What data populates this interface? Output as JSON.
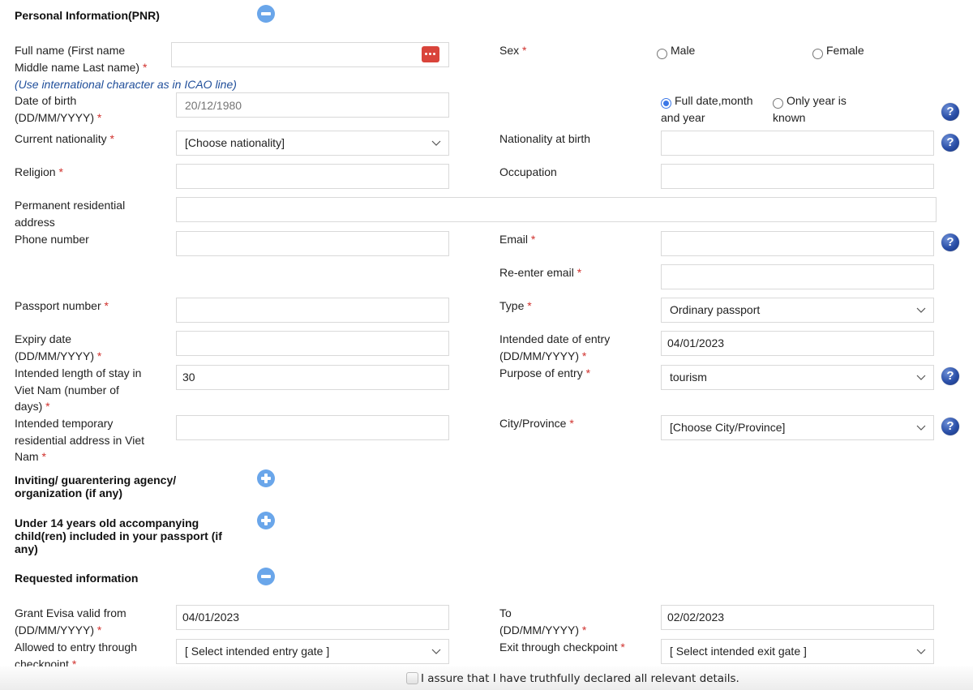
{
  "sections": {
    "personal": {
      "title": "Personal Information(PNR)",
      "toggle": "collapse"
    },
    "inviting": {
      "title_l1": "Inviting/ guarentering agency/",
      "title_l2": "organization (if any)",
      "toggle": "expand"
    },
    "children": {
      "title_l1": "Under 14 years old accompanying",
      "title_l2": "child(ren) included in your passport (if",
      "title_l3": "any)",
      "toggle": "expand"
    },
    "requested": {
      "title": "Requested information",
      "toggle": "collapse"
    }
  },
  "required_mark": "*",
  "fields": {
    "full_name": {
      "label_l1": "Full name (First name",
      "label_l2": "Middle name Last name)",
      "value": "",
      "note": "(Use international character as in ICAO line)"
    },
    "sex": {
      "label": "Sex",
      "options": [
        "Male",
        "Female"
      ],
      "selected": null
    },
    "dob": {
      "label_l1": "Date of birth",
      "label_l2": "(DD/MM/YYYY)",
      "placeholder": "20/12/1980",
      "value": ""
    },
    "dob_mode": {
      "options": [
        {
          "l1": "Full date,month",
          "l2": "and year"
        },
        {
          "l1": "Only year is",
          "l2": "known"
        }
      ],
      "selected": 0
    },
    "current_nationality": {
      "label": "Current nationality",
      "value": "[Choose nationality]"
    },
    "nationality_at_birth": {
      "label": "Nationality at birth",
      "value": ""
    },
    "religion": {
      "label": "Religion",
      "value": ""
    },
    "occupation": {
      "label": "Occupation",
      "value": ""
    },
    "permanent_address": {
      "label_l1": "Permanent residential",
      "label_l2": "address",
      "value": ""
    },
    "phone": {
      "label": "Phone number",
      "value": ""
    },
    "email": {
      "label": "Email",
      "value": ""
    },
    "reemail": {
      "label": "Re-enter email",
      "value": ""
    },
    "passport_number": {
      "label": "Passport number",
      "value": ""
    },
    "passport_type": {
      "label": "Type",
      "value": "Ordinary passport"
    },
    "expiry": {
      "label_l1": "Expiry date",
      "label_l2": "(DD/MM/YYYY)",
      "value": ""
    },
    "entry_date": {
      "label_l1": "Intended date of entry",
      "label_l2": "(DD/MM/YYYY)",
      "value": "04/01/2023"
    },
    "stay_length": {
      "label_l1": "Intended length of stay in",
      "label_l2": "Viet Nam (number of",
      "label_l3": "days)",
      "value": "30"
    },
    "purpose": {
      "label": "Purpose of entry",
      "value": "tourism"
    },
    "temp_address": {
      "label_l1": "Intended temporary",
      "label_l2": "residential address in Viet",
      "label_l3": "Nam",
      "value": ""
    },
    "city": {
      "label": "City/Province",
      "value": "[Choose City/Province]"
    },
    "evisa_from": {
      "label_l1": "Grant Evisa valid from",
      "label_l2": "(DD/MM/YYYY)",
      "value": "04/01/2023"
    },
    "evisa_to": {
      "label_l1": "To",
      "label_l2": "(DD/MM/YYYY)",
      "value": "02/02/2023"
    },
    "entry_gate": {
      "label_l1": "Allowed to entry through",
      "label_l2": "checkpoint",
      "value": "[ Select intended entry gate ]"
    },
    "exit_gate": {
      "label": "Exit through checkpoint",
      "value": "[ Select intended exit gate ]"
    }
  },
  "help_icon_glyph": "?",
  "assurance": {
    "label": "I assure that I have truthfully declared all relevant details.",
    "checked": false
  }
}
